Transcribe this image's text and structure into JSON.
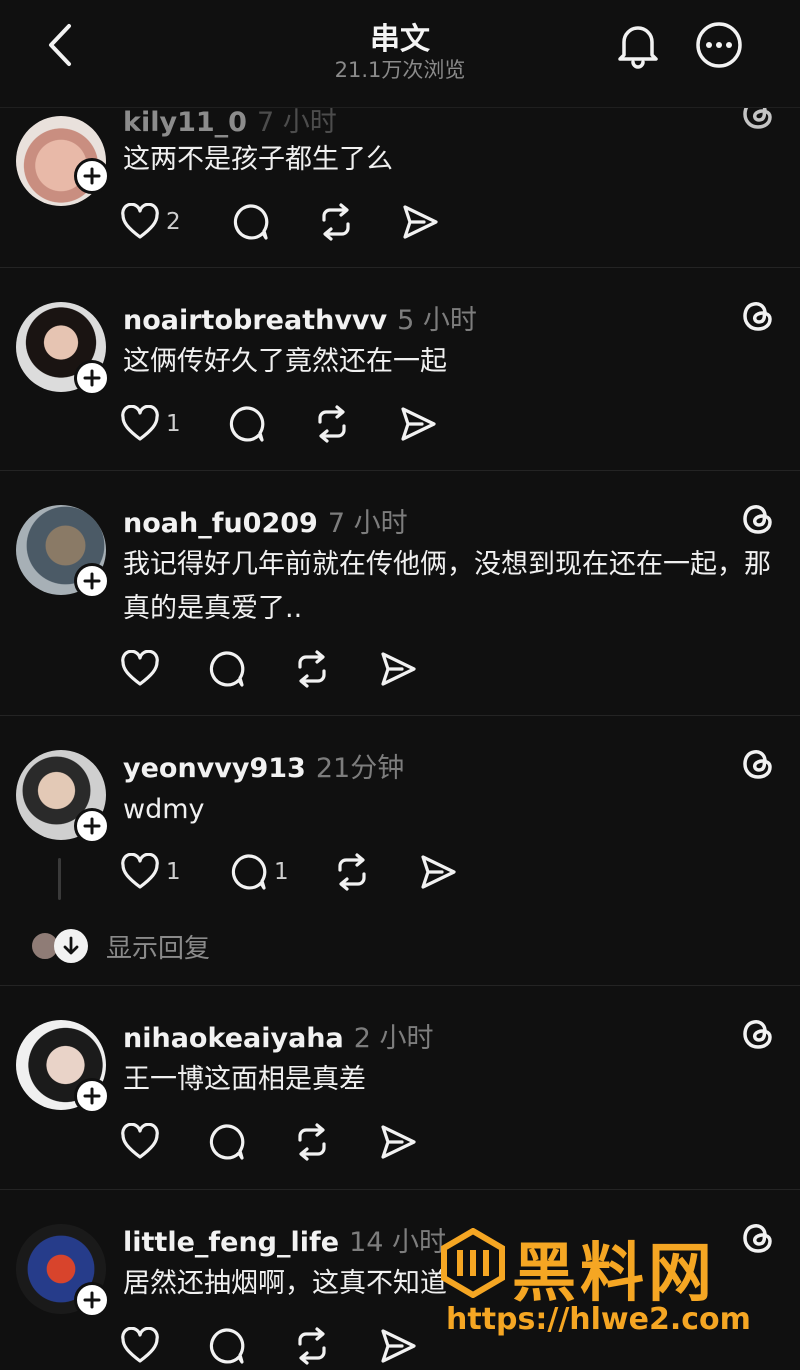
{
  "header": {
    "title": "串文",
    "views": "21.1万次浏览"
  },
  "posts": [
    {
      "user": "kily11_0",
      "time": "7 小时",
      "text": "这两不是孩子都生了么",
      "likes": "2",
      "replies": ""
    },
    {
      "user": "noairtobreathvvv",
      "time": "5 小时",
      "text": "这俩传好久了竟然还在一起",
      "likes": "1",
      "replies": ""
    },
    {
      "user": "noah_fu0209",
      "time": "7 小时",
      "text": "我记得好几年前就在传他俩，没想到现在还在一起，那真的是真爱了..",
      "likes": "",
      "replies": ""
    },
    {
      "user": "yeonvvy913",
      "time": "21分钟",
      "text": "wdmy",
      "likes": "1",
      "replies": "1"
    },
    {
      "user": "nihaokeaiyaha",
      "time": "2 小时",
      "text": "王一博这面相是真差",
      "likes": "",
      "replies": ""
    },
    {
      "user": "little_feng_life",
      "time": "14 小时",
      "text": "居然还抽烟啊，这真不知道",
      "likes": "",
      "replies": ""
    }
  ],
  "show_replies": "显示回复",
  "watermark": {
    "brand": "黑料网",
    "url": "https://hlwe2.com"
  },
  "icons": [
    "back-icon",
    "bell-icon",
    "more-icon",
    "threads-icon",
    "heart-icon",
    "comment-icon",
    "repost-icon",
    "share-icon",
    "plus-icon"
  ]
}
